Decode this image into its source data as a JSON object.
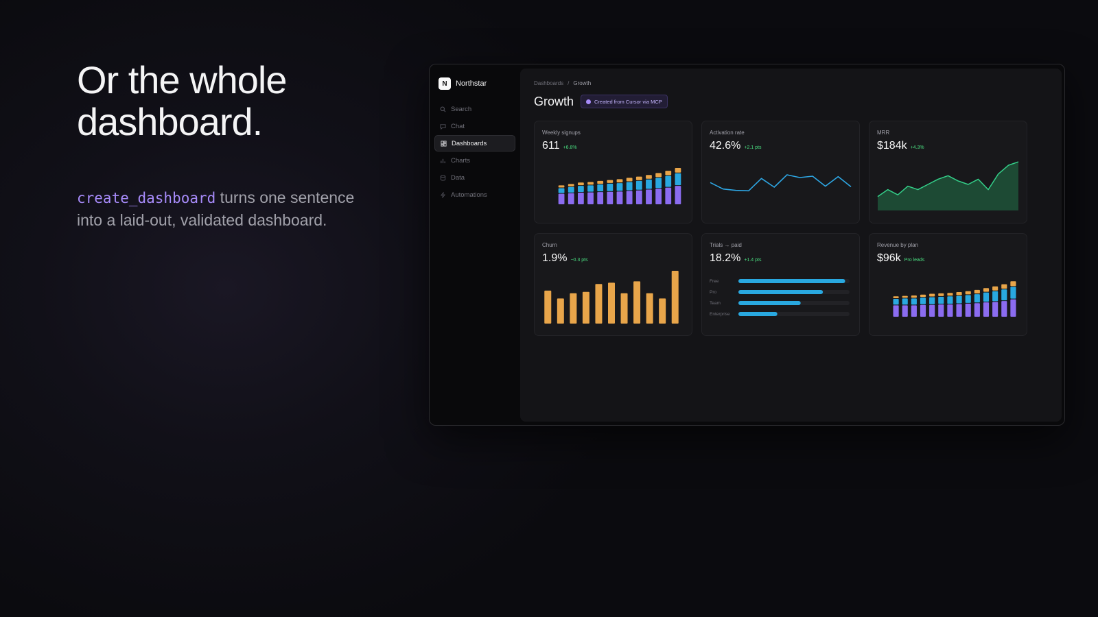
{
  "hero": {
    "title": "Or the whole dashboard.",
    "code": "create_dashboard",
    "description": " turns one sentence into a laid-out, validated dashboard."
  },
  "app": {
    "brand": "Northstar",
    "logo_letter": "N",
    "nav": [
      {
        "label": "Search",
        "icon": "search-icon"
      },
      {
        "label": "Chat",
        "icon": "chat-icon"
      },
      {
        "label": "Dashboards",
        "icon": "dashboard-icon",
        "active": true
      },
      {
        "label": "Charts",
        "icon": "chart-icon"
      },
      {
        "label": "Data",
        "icon": "database-icon"
      },
      {
        "label": "Automations",
        "icon": "lightning-icon"
      }
    ]
  },
  "page": {
    "breadcrumb": [
      "Dashboards",
      "Growth"
    ],
    "title": "Growth",
    "badge": "Created from Cursor via MCP"
  },
  "colors": {
    "purple": "#8b6cf0",
    "blue": "#29a8e0",
    "orange": "#e8a54a",
    "green_fill": "#1d4a34",
    "green_line": "#34d08a",
    "line_blue": "#2ea8e6",
    "positive": "#4ade80"
  },
  "cards": {
    "weekly_signups": {
      "title": "Weekly signups",
      "value": "611",
      "delta": "+6.8%"
    },
    "activation_rate": {
      "title": "Activation rate",
      "value": "42.6%",
      "delta": "+2.1 pts"
    },
    "mrr": {
      "title": "MRR",
      "value": "$184k",
      "delta": "+4.3%"
    },
    "churn": {
      "title": "Churn",
      "value": "1.9%",
      "delta": "−0.3 pts"
    },
    "trials": {
      "title": "Trials → paid",
      "value": "18.2%",
      "delta": "+1.4 pts"
    },
    "revenue_by_plan": {
      "title": "Revenue by plan",
      "value": "$96k",
      "delta": "Pro leads"
    }
  },
  "chart_data": [
    {
      "id": "weekly_signups",
      "type": "bar",
      "stacked": true,
      "series": [
        {
          "values": [
            4,
            4.2,
            4.4,
            4.5,
            4.6,
            4.7,
            4.8,
            5,
            5.2,
            5.5,
            5.8,
            6.2,
            6.8
          ]
        },
        {
          "values": [
            2,
            2.2,
            2.4,
            2.5,
            2.7,
            2.9,
            3,
            3.2,
            3.4,
            3.6,
            3.9,
            4.2,
            4.5
          ]
        },
        {
          "values": [
            1,
            1.1,
            1.2,
            1.2,
            1.3,
            1.3,
            1.4,
            1.5,
            1.5,
            1.6,
            1.7,
            1.8,
            1.9
          ]
        }
      ]
    },
    {
      "id": "activation_rate",
      "type": "line",
      "values": [
        41.2,
        39.8,
        39.5,
        39.4,
        42.1,
        40.2,
        42.9,
        42.3,
        42.6,
        40.4,
        42.5,
        40.3
      ]
    },
    {
      "id": "mrr",
      "type": "area",
      "values": [
        168,
        172,
        169,
        174,
        172,
        175,
        178,
        180,
        177,
        175,
        178,
        172,
        181,
        186,
        188
      ]
    },
    {
      "id": "churn",
      "type": "bar",
      "values": [
        1.25,
        0.95,
        1.15,
        1.2,
        1.5,
        1.55,
        1.15,
        1.6,
        1.15,
        0.95,
        2.0
      ]
    },
    {
      "id": "trials",
      "type": "bar",
      "orientation": "horizontal",
      "categories": [
        "Free",
        "Pro",
        "Team",
        "Enterprise"
      ],
      "values": [
        96,
        76,
        56,
        35
      ]
    },
    {
      "id": "revenue_by_plan",
      "type": "bar",
      "stacked": true,
      "series": [
        {
          "values": [
            2.8,
            2.8,
            2.8,
            2.9,
            2.9,
            3.0,
            3.0,
            3.1,
            3.2,
            3.3,
            3.5,
            3.6,
            3.8,
            4.2
          ]
        },
        {
          "values": [
            1.5,
            1.6,
            1.6,
            1.7,
            1.8,
            1.8,
            1.9,
            1.9,
            2.0,
            2.1,
            2.3,
            2.5,
            2.7,
            2.9
          ]
        },
        {
          "values": [
            0.6,
            0.6,
            0.7,
            0.7,
            0.8,
            0.8,
            0.8,
            0.9,
            0.9,
            1.0,
            1.0,
            1.1,
            1.2,
            1.3
          ]
        }
      ]
    }
  ]
}
